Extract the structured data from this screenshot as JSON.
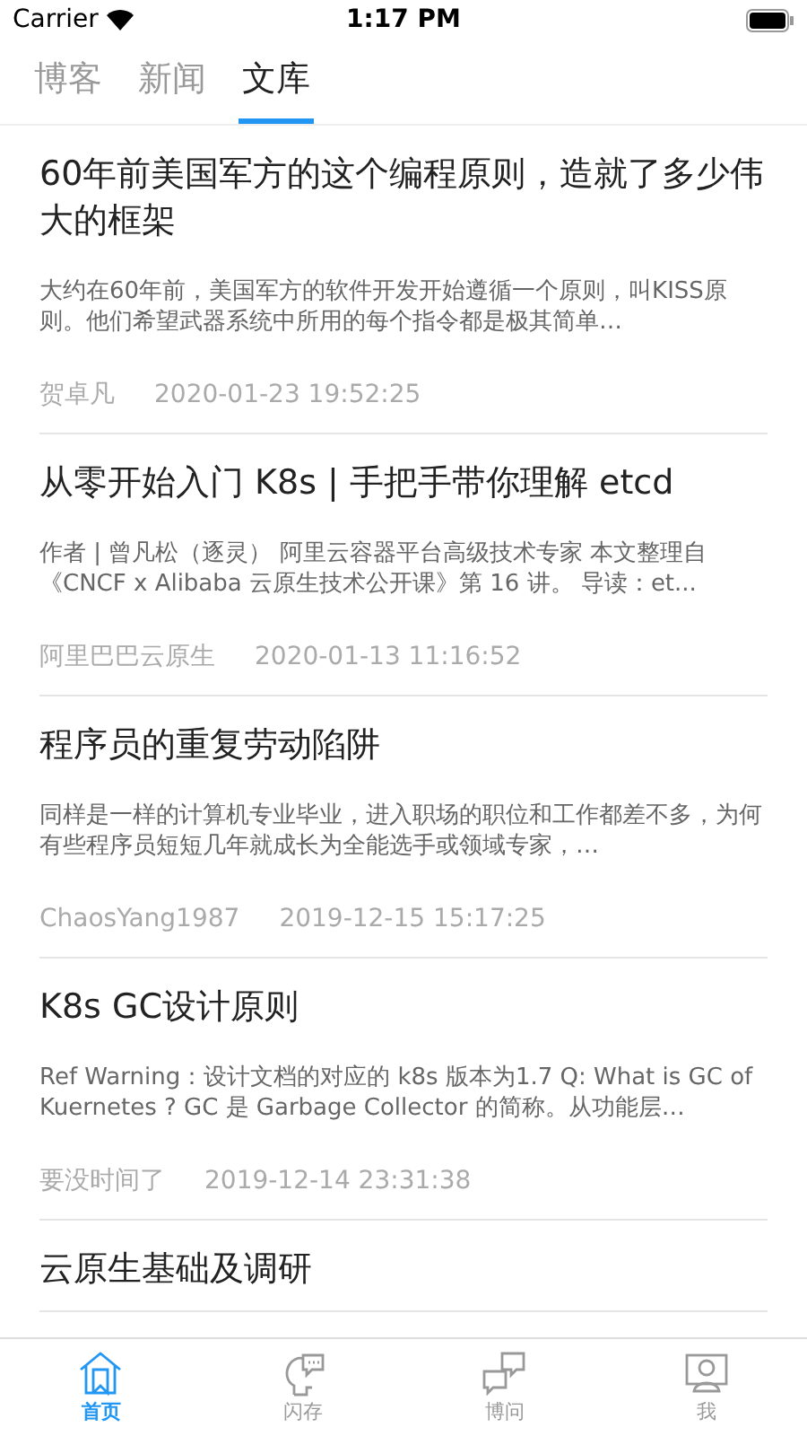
{
  "status_bar": {
    "carrier": "Carrier",
    "time": "1:17 PM"
  },
  "tabs": [
    {
      "label": "博客",
      "selected": false
    },
    {
      "label": "新闻",
      "selected": false
    },
    {
      "label": "文库",
      "selected": true
    }
  ],
  "articles": [
    {
      "title": "60年前美国军方的这个编程原则，造就了多少伟大的框架",
      "summary": "大约在60年前，美国军方的软件开发开始遵循一个原则，叫KISS原则。他们希望武器系统中所用的每个指令都是极其简单…",
      "author": "贺卓凡",
      "date": "2020-01-23 19:52:25"
    },
    {
      "title": "从零开始入门 K8s | 手把手带你理解 etcd",
      "summary": "作者 | 曾凡松（逐灵） 阿里云容器平台高级技术专家 本文整理自《CNCF x Alibaba 云原生技术公开课》第 16 讲。 导读：et...",
      "author": "阿里巴巴云原生",
      "date": "2020-01-13 11:16:52"
    },
    {
      "title": "程序员的重复劳动陷阱",
      "summary": "同样是一样的计算机专业毕业，进入职场的职位和工作都差不多，为何有些程序员短短几年就成长为全能选手或领域专家，…",
      "author": "ChaosYang1987",
      "date": "2019-12-15 15:17:25"
    },
    {
      "title": "K8s GC设计原则",
      "summary": "Ref Warning：设计文档的对应的 k8s 版本为1.7 Q: What is GC of Kuernetes ? GC 是 Garbage Collector 的简称。从功能层…",
      "author": "要没时间了",
      "date": "2019-12-14 23:31:38"
    },
    {
      "title": "云原生基础及调研"
    }
  ],
  "bottom_tabs": [
    {
      "kind": "home",
      "label": "首页",
      "selected": true
    },
    {
      "kind": "flash",
      "label": "闪存",
      "selected": false
    },
    {
      "kind": "qa",
      "label": "博问",
      "selected": false
    },
    {
      "kind": "me",
      "label": "我",
      "selected": false
    }
  ]
}
